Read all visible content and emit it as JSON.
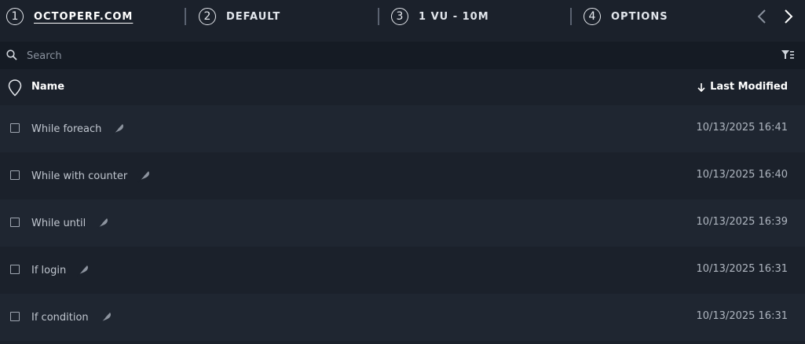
{
  "stepper": {
    "steps": [
      {
        "number": "1",
        "label": "OCTOPERF.COM",
        "active": true
      },
      {
        "number": "2",
        "label": "DEFAULT",
        "active": false
      },
      {
        "number": "3",
        "label": "1 VU - 10M",
        "active": false
      },
      {
        "number": "4",
        "label": "OPTIONS",
        "active": false
      }
    ],
    "prev_icon": "chevron-left-icon",
    "next_icon": "chevron-right-icon"
  },
  "search": {
    "placeholder": "Search",
    "value": "",
    "search_icon": "search-icon",
    "filter_icon": "filter-icon"
  },
  "table": {
    "columns": {
      "name": "Name",
      "last_modified": "Last Modified",
      "sort_direction": "descending"
    },
    "rows": [
      {
        "name": "While foreach",
        "modified": "10/13/2025 16:41"
      },
      {
        "name": "While with counter",
        "modified": "10/13/2025 16:40"
      },
      {
        "name": "While until",
        "modified": "10/13/2025 16:39"
      },
      {
        "name": "If login",
        "modified": "10/13/2025 16:31"
      },
      {
        "name": "If condition",
        "modified": "10/13/2025 16:31"
      }
    ]
  },
  "colors": {
    "background": "#1b212b",
    "row_alt": "#1f2631",
    "search_bg": "#151b24",
    "text": "#c0c6cf",
    "heading": "#ffffff"
  }
}
